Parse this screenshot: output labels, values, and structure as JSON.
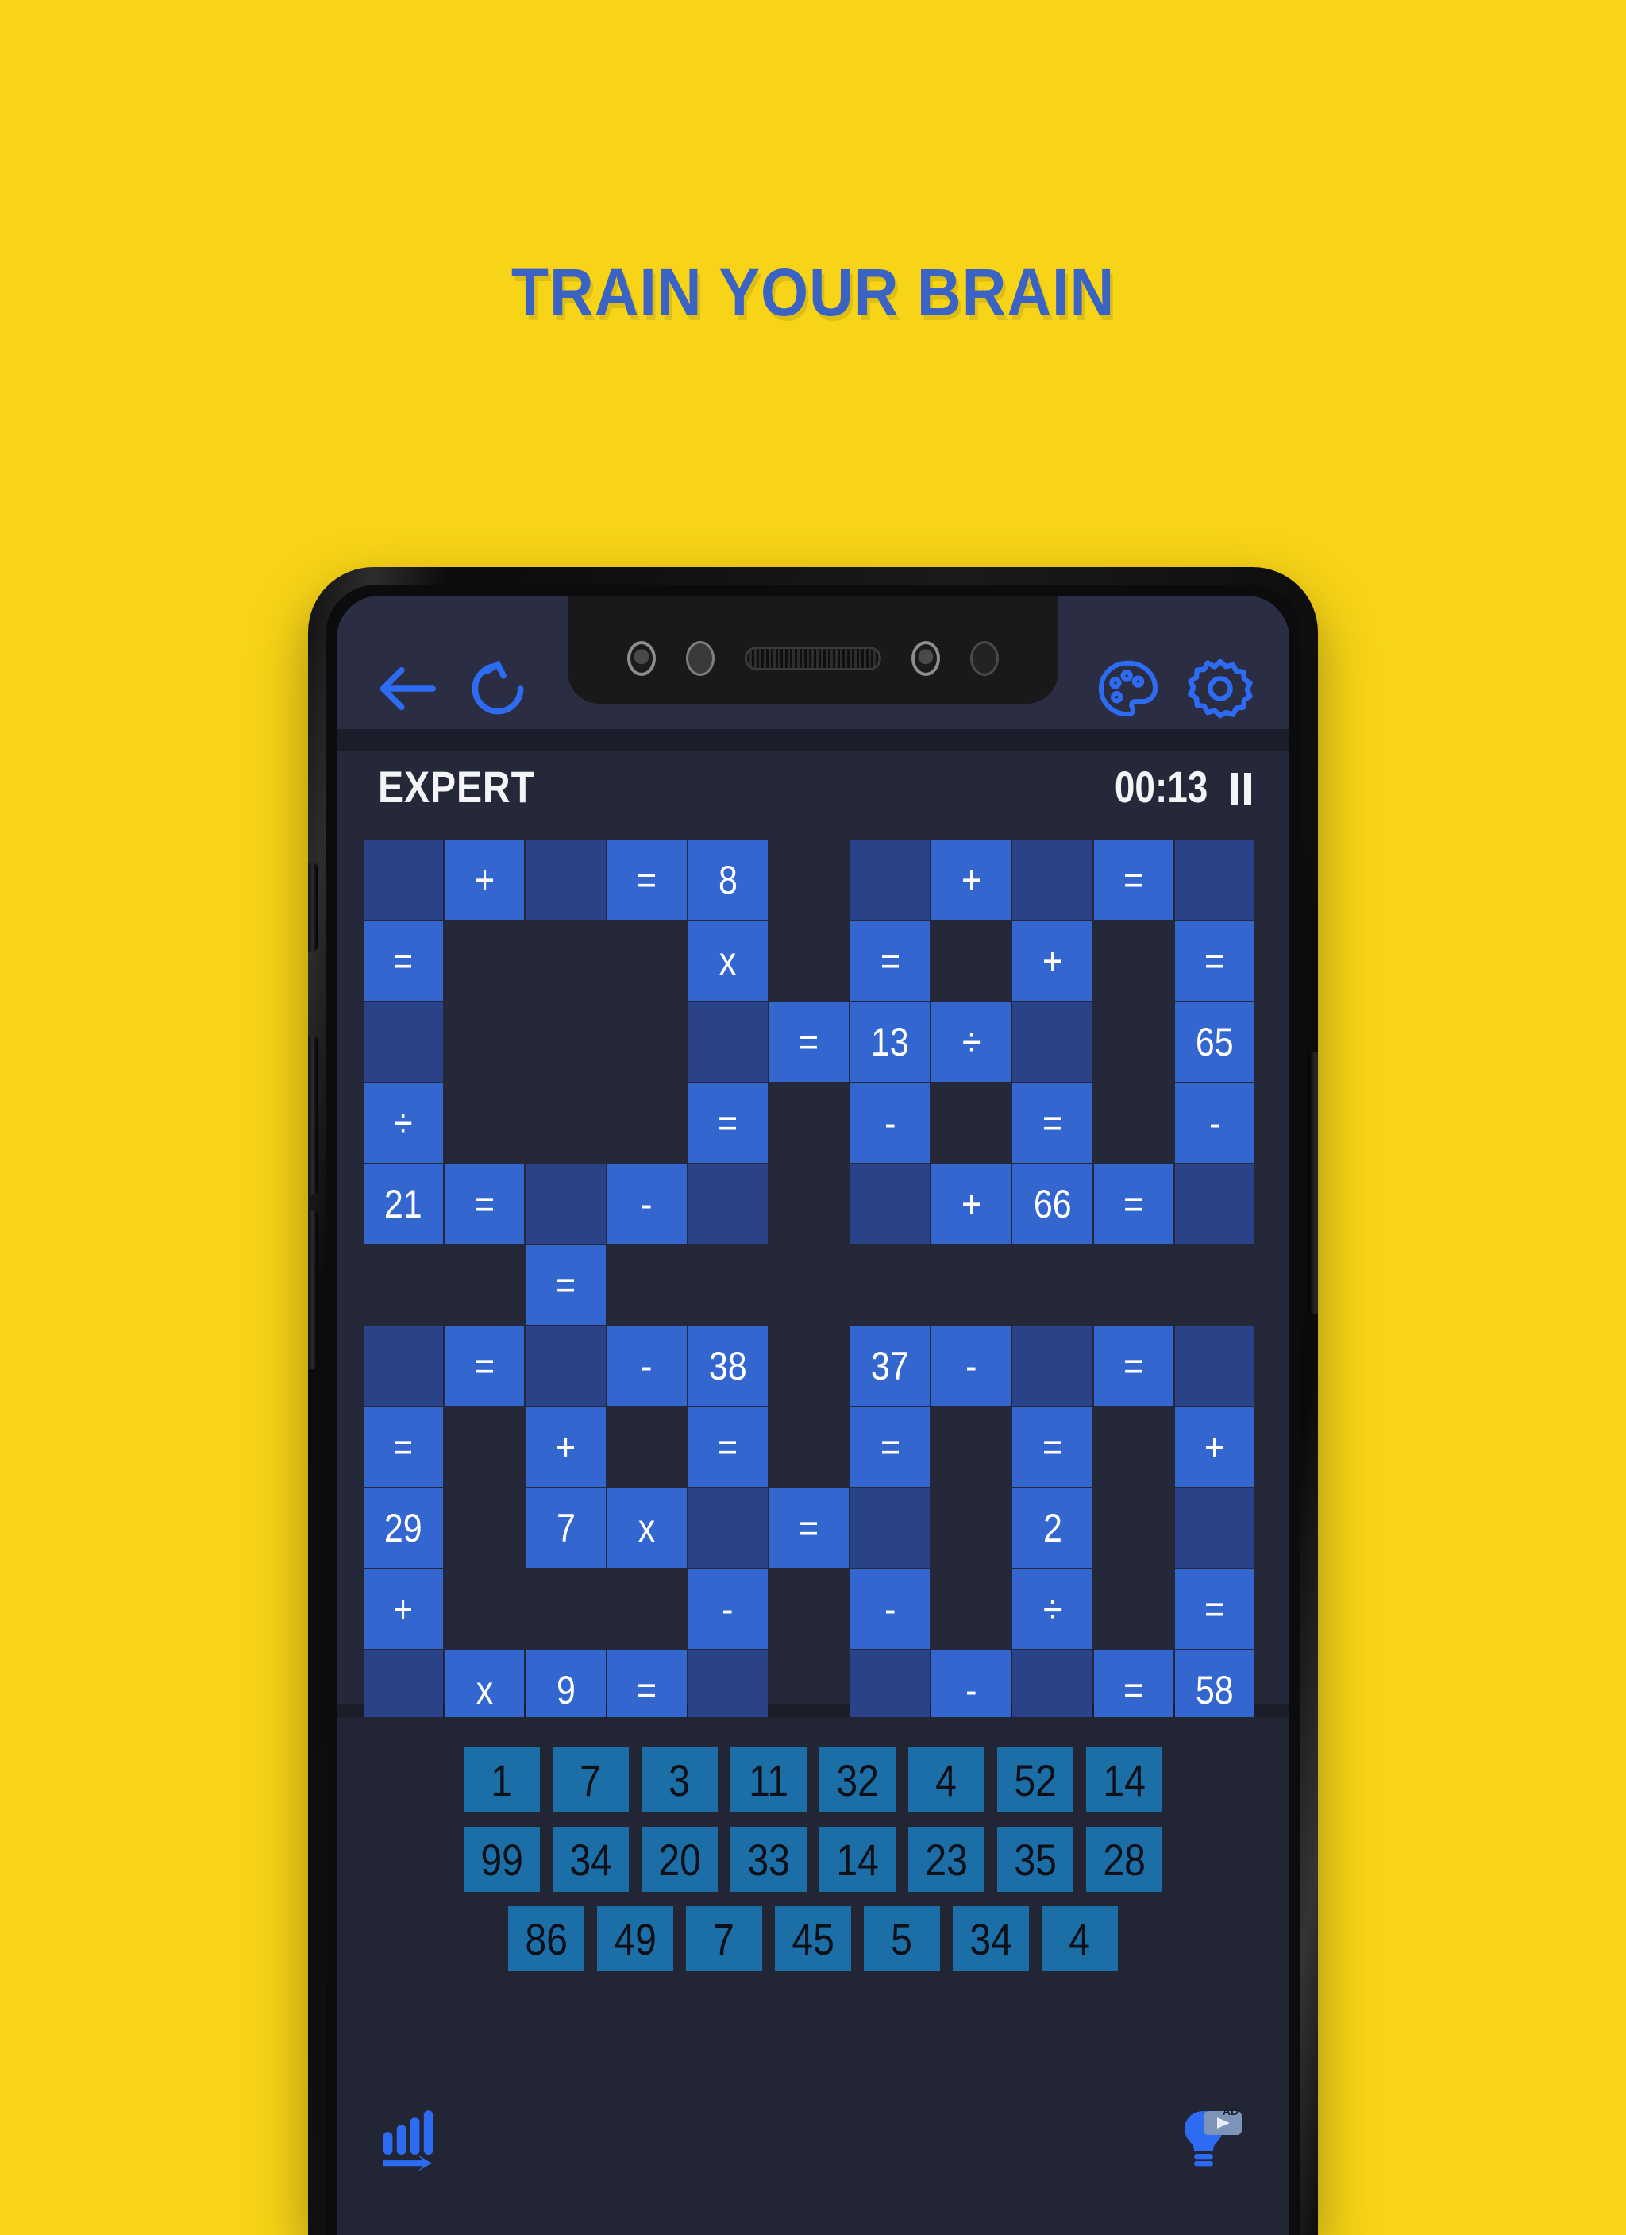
{
  "headline": "TRAIN YOUR BRAIN",
  "colors": {
    "page_background": "#F7D417",
    "headline": "#3A63C4",
    "accent_blue": "#2C6BF2",
    "cell_slot": "#2A4287",
    "cell_filled": "#3367CF",
    "tray_tile": "#1C6FA6",
    "screen_background": "#252839"
  },
  "toolbar": {
    "back_icon": "arrow-left-icon",
    "restart_icon": "refresh-icon",
    "theme_icon": "palette-icon",
    "settings_icon": "gear-icon"
  },
  "game_header": {
    "difficulty": "EXPERT",
    "timer": "00:13",
    "pause_icon": "pause-icon"
  },
  "board": {
    "columns": 11,
    "rows": 12,
    "legend": {
      "empty": "background, no tile",
      "slot": "empty drop slot (dark blue)",
      "filled": "locked clue tile (bright blue)"
    },
    "cells": [
      [
        {
          "t": "slot",
          "v": ""
        },
        {
          "t": "fill",
          "v": "+"
        },
        {
          "t": "slot",
          "v": ""
        },
        {
          "t": "fill",
          "v": "="
        },
        {
          "t": "fill",
          "v": "8"
        },
        {
          "t": "empty",
          "v": ""
        },
        {
          "t": "slot",
          "v": ""
        },
        {
          "t": "fill",
          "v": "+"
        },
        {
          "t": "slot",
          "v": ""
        },
        {
          "t": "fill",
          "v": "="
        },
        {
          "t": "slot",
          "v": ""
        }
      ],
      [
        {
          "t": "fill",
          "v": "="
        },
        {
          "t": "empty",
          "v": ""
        },
        {
          "t": "empty",
          "v": ""
        },
        {
          "t": "empty",
          "v": ""
        },
        {
          "t": "fill",
          "v": "x"
        },
        {
          "t": "empty",
          "v": ""
        },
        {
          "t": "fill",
          "v": "="
        },
        {
          "t": "empty",
          "v": ""
        },
        {
          "t": "fill",
          "v": "+"
        },
        {
          "t": "empty",
          "v": ""
        },
        {
          "t": "fill",
          "v": "="
        }
      ],
      [
        {
          "t": "slot",
          "v": ""
        },
        {
          "t": "empty",
          "v": ""
        },
        {
          "t": "empty",
          "v": ""
        },
        {
          "t": "empty",
          "v": ""
        },
        {
          "t": "slot",
          "v": ""
        },
        {
          "t": "fill",
          "v": "="
        },
        {
          "t": "fill",
          "v": "13"
        },
        {
          "t": "fill",
          "v": "÷"
        },
        {
          "t": "slot",
          "v": ""
        },
        {
          "t": "empty",
          "v": ""
        },
        {
          "t": "fill",
          "v": "65"
        }
      ],
      [
        {
          "t": "fill",
          "v": "÷"
        },
        {
          "t": "empty",
          "v": ""
        },
        {
          "t": "empty",
          "v": ""
        },
        {
          "t": "empty",
          "v": ""
        },
        {
          "t": "fill",
          "v": "="
        },
        {
          "t": "empty",
          "v": ""
        },
        {
          "t": "fill",
          "v": "-"
        },
        {
          "t": "empty",
          "v": ""
        },
        {
          "t": "fill",
          "v": "="
        },
        {
          "t": "empty",
          "v": ""
        },
        {
          "t": "fill",
          "v": "-"
        }
      ],
      [
        {
          "t": "fill",
          "v": "21"
        },
        {
          "t": "fill",
          "v": "="
        },
        {
          "t": "slot",
          "v": ""
        },
        {
          "t": "fill",
          "v": "-"
        },
        {
          "t": "slot",
          "v": ""
        },
        {
          "t": "empty",
          "v": ""
        },
        {
          "t": "slot",
          "v": ""
        },
        {
          "t": "fill",
          "v": "+"
        },
        {
          "t": "fill",
          "v": "66"
        },
        {
          "t": "fill",
          "v": "="
        },
        {
          "t": "slot",
          "v": ""
        }
      ],
      [
        {
          "t": "empty",
          "v": ""
        },
        {
          "t": "empty",
          "v": ""
        },
        {
          "t": "fill",
          "v": "="
        },
        {
          "t": "empty",
          "v": ""
        },
        {
          "t": "empty",
          "v": ""
        },
        {
          "t": "empty",
          "v": ""
        },
        {
          "t": "empty",
          "v": ""
        },
        {
          "t": "empty",
          "v": ""
        },
        {
          "t": "empty",
          "v": ""
        },
        {
          "t": "empty",
          "v": ""
        },
        {
          "t": "empty",
          "v": ""
        }
      ],
      [
        {
          "t": "slot",
          "v": ""
        },
        {
          "t": "fill",
          "v": "="
        },
        {
          "t": "slot",
          "v": ""
        },
        {
          "t": "fill",
          "v": "-"
        },
        {
          "t": "fill",
          "v": "38"
        },
        {
          "t": "empty",
          "v": ""
        },
        {
          "t": "fill",
          "v": "37"
        },
        {
          "t": "fill",
          "v": "-"
        },
        {
          "t": "slot",
          "v": ""
        },
        {
          "t": "fill",
          "v": "="
        },
        {
          "t": "slot",
          "v": ""
        }
      ],
      [
        {
          "t": "fill",
          "v": "="
        },
        {
          "t": "empty",
          "v": ""
        },
        {
          "t": "fill",
          "v": "+"
        },
        {
          "t": "empty",
          "v": ""
        },
        {
          "t": "fill",
          "v": "="
        },
        {
          "t": "empty",
          "v": ""
        },
        {
          "t": "fill",
          "v": "="
        },
        {
          "t": "empty",
          "v": ""
        },
        {
          "t": "fill",
          "v": "="
        },
        {
          "t": "empty",
          "v": ""
        },
        {
          "t": "fill",
          "v": "+"
        }
      ],
      [
        {
          "t": "fill",
          "v": "29"
        },
        {
          "t": "empty",
          "v": ""
        },
        {
          "t": "fill",
          "v": "7"
        },
        {
          "t": "fill",
          "v": "x"
        },
        {
          "t": "slot",
          "v": ""
        },
        {
          "t": "fill",
          "v": "="
        },
        {
          "t": "slot",
          "v": ""
        },
        {
          "t": "empty",
          "v": ""
        },
        {
          "t": "fill",
          "v": "2"
        },
        {
          "t": "empty",
          "v": ""
        },
        {
          "t": "slot",
          "v": ""
        }
      ],
      [
        {
          "t": "fill",
          "v": "+"
        },
        {
          "t": "empty",
          "v": ""
        },
        {
          "t": "empty",
          "v": ""
        },
        {
          "t": "empty",
          "v": ""
        },
        {
          "t": "fill",
          "v": "-"
        },
        {
          "t": "empty",
          "v": ""
        },
        {
          "t": "fill",
          "v": "-"
        },
        {
          "t": "empty",
          "v": ""
        },
        {
          "t": "fill",
          "v": "÷"
        },
        {
          "t": "empty",
          "v": ""
        },
        {
          "t": "fill",
          "v": "="
        }
      ],
      [
        {
          "t": "slot",
          "v": ""
        },
        {
          "t": "fill",
          "v": "x"
        },
        {
          "t": "fill",
          "v": "9"
        },
        {
          "t": "fill",
          "v": "="
        },
        {
          "t": "slot",
          "v": ""
        },
        {
          "t": "empty",
          "v": ""
        },
        {
          "t": "slot",
          "v": ""
        },
        {
          "t": "fill",
          "v": "-"
        },
        {
          "t": "slot",
          "v": ""
        },
        {
          "t": "fill",
          "v": "="
        },
        {
          "t": "fill",
          "v": "58"
        }
      ]
    ]
  },
  "tray": {
    "rows": [
      [
        "1",
        "7",
        "3",
        "11",
        "32",
        "4",
        "52",
        "14"
      ],
      [
        "99",
        "34",
        "20",
        "33",
        "14",
        "23",
        "35",
        "28"
      ],
      [
        "86",
        "49",
        "7",
        "45",
        "5",
        "34",
        "4"
      ]
    ]
  },
  "bottom_bar": {
    "stats_icon": "bar-chart-icon",
    "hint_icon": "lightbulb-ad-video-icon",
    "hint_badge": "AD"
  }
}
